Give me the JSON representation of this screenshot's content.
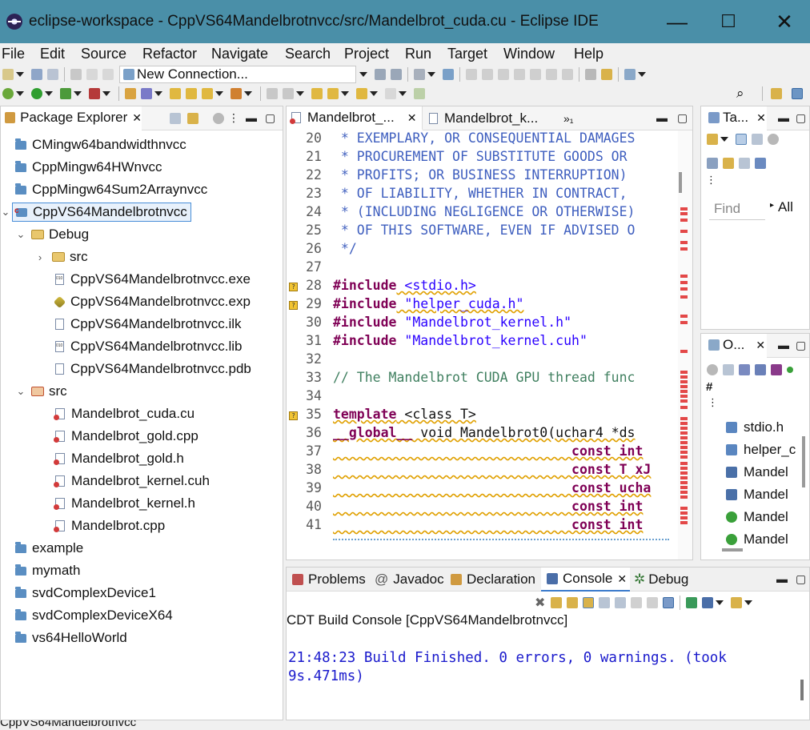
{
  "window": {
    "title": "eclipse-workspace - CppVS64Mandelbrotnvcc/src/Mandelbrot_cuda.cu - Eclipse IDE",
    "minimize": "—",
    "maximize": "☐",
    "close": "✕"
  },
  "menu": [
    "File",
    "Edit",
    "Source",
    "Refactor",
    "Navigate",
    "Search",
    "Project",
    "Run",
    "Target",
    "Window",
    "Help"
  ],
  "toolbar": {
    "connection": "New Connection..."
  },
  "package_explorer": {
    "title": "Package Explorer",
    "items": [
      {
        "label": "CMingw64bandwidthnvcc"
      },
      {
        "label": "CppMingw64HWnvcc"
      },
      {
        "label": "CppMingw64Sum2Arraynvcc"
      },
      {
        "label": "CppVS64Mandelbrotnvcc"
      },
      {
        "label": "Debug"
      },
      {
        "label": "src"
      },
      {
        "label": "CppVS64Mandelbrotnvcc.exe"
      },
      {
        "label": "CppVS64Mandelbrotnvcc.exp"
      },
      {
        "label": "CppVS64Mandelbrotnvcc.ilk"
      },
      {
        "label": "CppVS64Mandelbrotnvcc.lib"
      },
      {
        "label": "CppVS64Mandelbrotnvcc.pdb"
      },
      {
        "label": "src"
      },
      {
        "label": "Mandelbrot_cuda.cu"
      },
      {
        "label": "Mandelbrot_gold.cpp"
      },
      {
        "label": "Mandelbrot_gold.h"
      },
      {
        "label": "Mandelbrot_kernel.cuh"
      },
      {
        "label": "Mandelbrot_kernel.h"
      },
      {
        "label": "Mandelbrot.cpp"
      },
      {
        "label": "example"
      },
      {
        "label": "mymath"
      },
      {
        "label": "svdComplexDevice1"
      },
      {
        "label": "svdComplexDeviceX64"
      },
      {
        "label": "vs64HelloWorld"
      }
    ]
  },
  "editor": {
    "tabs": [
      "Mandelbrot_...",
      "Mandelbrot_k..."
    ],
    "overflow": "»₁",
    "lines": [
      {
        "n": "20",
        "text": " * EXEMPLARY, OR CONSEQUENTIAL DAMAGES"
      },
      {
        "n": "21",
        "text": " * PROCUREMENT OF SUBSTITUTE GOODS OR"
      },
      {
        "n": "22",
        "text": " * PROFITS; OR BUSINESS INTERRUPTION)"
      },
      {
        "n": "23",
        "text": " * OF LIABILITY, WHETHER IN CONTRACT,"
      },
      {
        "n": "24",
        "text": " * (INCLUDING NEGLIGENCE OR OTHERWISE)"
      },
      {
        "n": "25",
        "text": " * OF THIS SOFTWARE, EVEN IF ADVISED O"
      },
      {
        "n": "26",
        "text": " */"
      },
      {
        "n": "27",
        "text": ""
      },
      {
        "n": "28",
        "pre": "#include",
        "rest": " <stdio.h>"
      },
      {
        "n": "29",
        "pre": "#include",
        "rest": " \"helper_cuda.h\""
      },
      {
        "n": "30",
        "pre": "#include",
        "rest": " \"Mandelbrot_kernel.h\""
      },
      {
        "n": "31",
        "pre": "#include",
        "rest": " \"Mandelbrot_kernel.cuh\""
      },
      {
        "n": "32",
        "text": ""
      },
      {
        "n": "33",
        "text": "// The Mandelbrot CUDA GPU thread func"
      },
      {
        "n": "34",
        "text": ""
      },
      {
        "n": "35",
        "pre": "template",
        "rest": " <class T>"
      },
      {
        "n": "36",
        "pre": "__global__",
        "rest": " void Mandelbrot0(uchar4 *ds"
      },
      {
        "n": "37",
        "text": "                              const int"
      },
      {
        "n": "38",
        "text": "                              const T xJ"
      },
      {
        "n": "39",
        "text": "                              const ucha"
      },
      {
        "n": "40",
        "text": "                              const int"
      },
      {
        "n": "41",
        "text": "                              const int"
      }
    ]
  },
  "task_panel": {
    "title": "Ta...",
    "find_placeholder": "Find",
    "all_label": "All"
  },
  "outline": {
    "title": "O...",
    "items": [
      "stdio.h",
      "helper_c",
      "Mandel",
      "Mandel",
      "Mandel",
      "Mandel"
    ]
  },
  "console": {
    "tabs": [
      "Problems",
      "Javadoc",
      "Declaration",
      "Console",
      "Debug"
    ],
    "label": "CDT Build Console [CppVS64Mandelbrotnvcc]",
    "output_line1": "21:48:23 Build Finished. 0 errors, 0 warnings. (took",
    "output_line2": "9s.471ms)"
  },
  "status": {
    "text": "CppVS64Mandelbrotnvcc"
  }
}
